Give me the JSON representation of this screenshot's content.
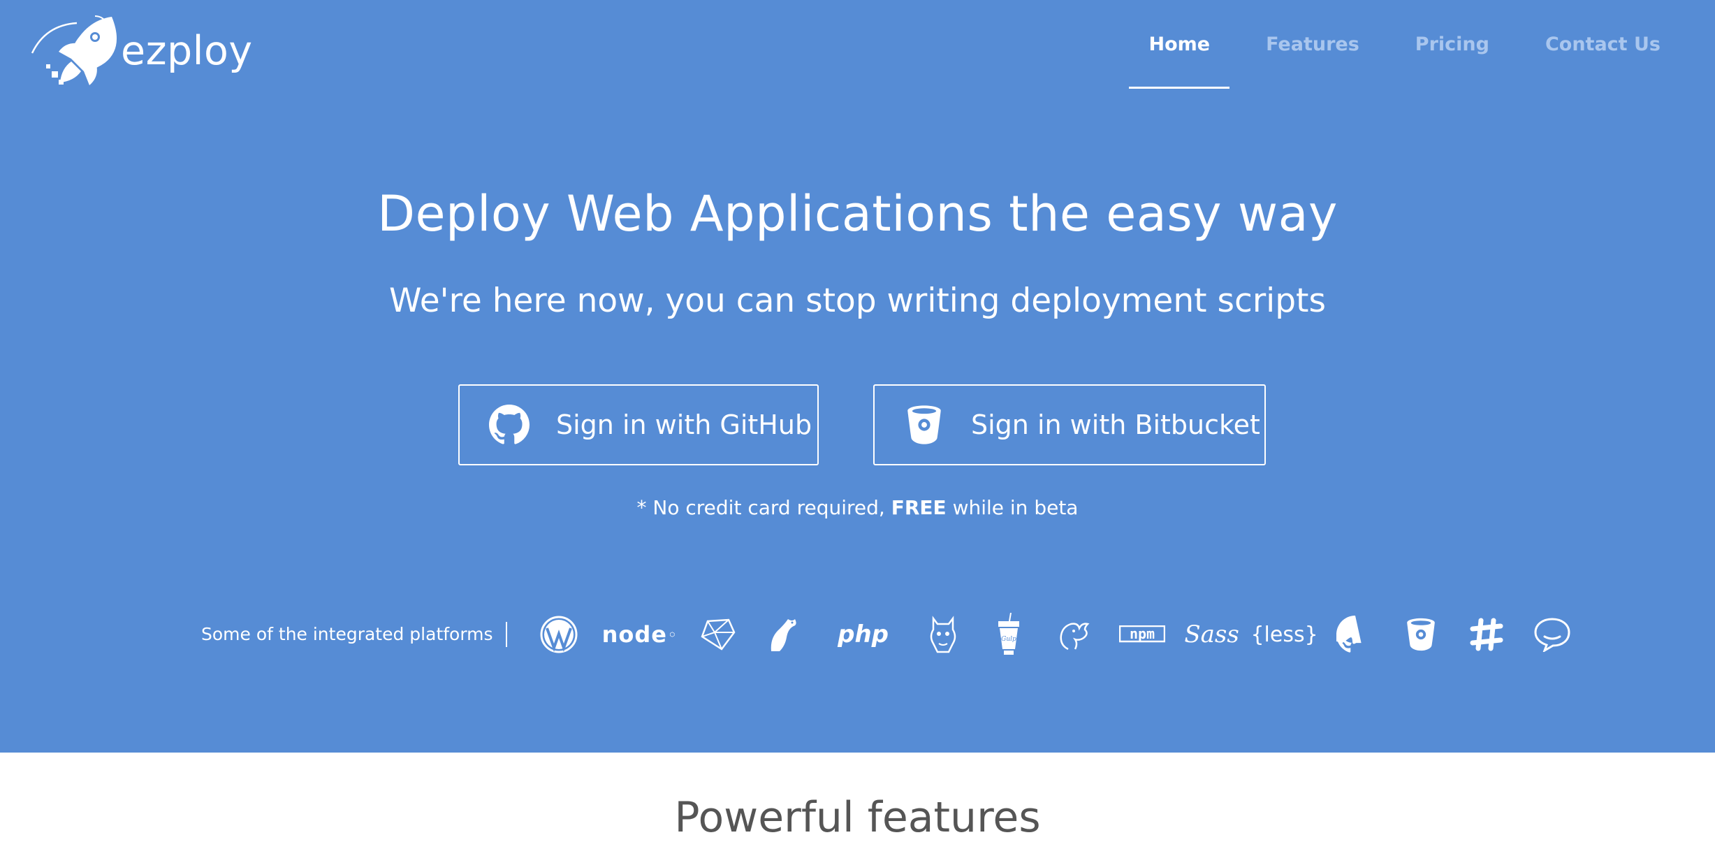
{
  "brand": {
    "name": "ezploy",
    "logo_icon": "rocket-icon"
  },
  "nav": {
    "items": [
      {
        "label": "Home",
        "active": true
      },
      {
        "label": "Features",
        "active": false
      },
      {
        "label": "Pricing",
        "active": false
      },
      {
        "label": "Contact Us",
        "active": false
      }
    ]
  },
  "hero": {
    "title": "Deploy Web Applications the easy way",
    "subtitle": "We're here now, you can stop writing deployment scripts",
    "github_button": "Sign in with GitHub",
    "bitbucket_button": "Sign in with Bitbucket",
    "note_prefix": "* No credit card required, ",
    "note_bold": "FREE",
    "note_suffix": " while in beta"
  },
  "platforms": {
    "label": "Some of the integrated platforms",
    "icons": [
      {
        "name": "wordpress-icon"
      },
      {
        "name": "nodejs-icon",
        "text": "node"
      },
      {
        "name": "ruby-icon"
      },
      {
        "name": "laravel-icon"
      },
      {
        "name": "php-icon",
        "text": "php"
      },
      {
        "name": "grunt-icon"
      },
      {
        "name": "gulp-icon"
      },
      {
        "name": "mysql-icon"
      },
      {
        "name": "npm-icon",
        "text": "npm"
      },
      {
        "name": "sass-icon",
        "text": "Sass"
      },
      {
        "name": "less-icon",
        "text": "{less}"
      },
      {
        "name": "github-icon"
      },
      {
        "name": "bitbucket-icon"
      },
      {
        "name": "slack-icon"
      },
      {
        "name": "hipchat-icon"
      }
    ]
  },
  "features": {
    "title": "Powerful features"
  },
  "colors": {
    "hero_bg": "#568cd5",
    "nav_inactive": "#a9c6ee",
    "text": "#ffffff",
    "features_title": "#555555"
  }
}
